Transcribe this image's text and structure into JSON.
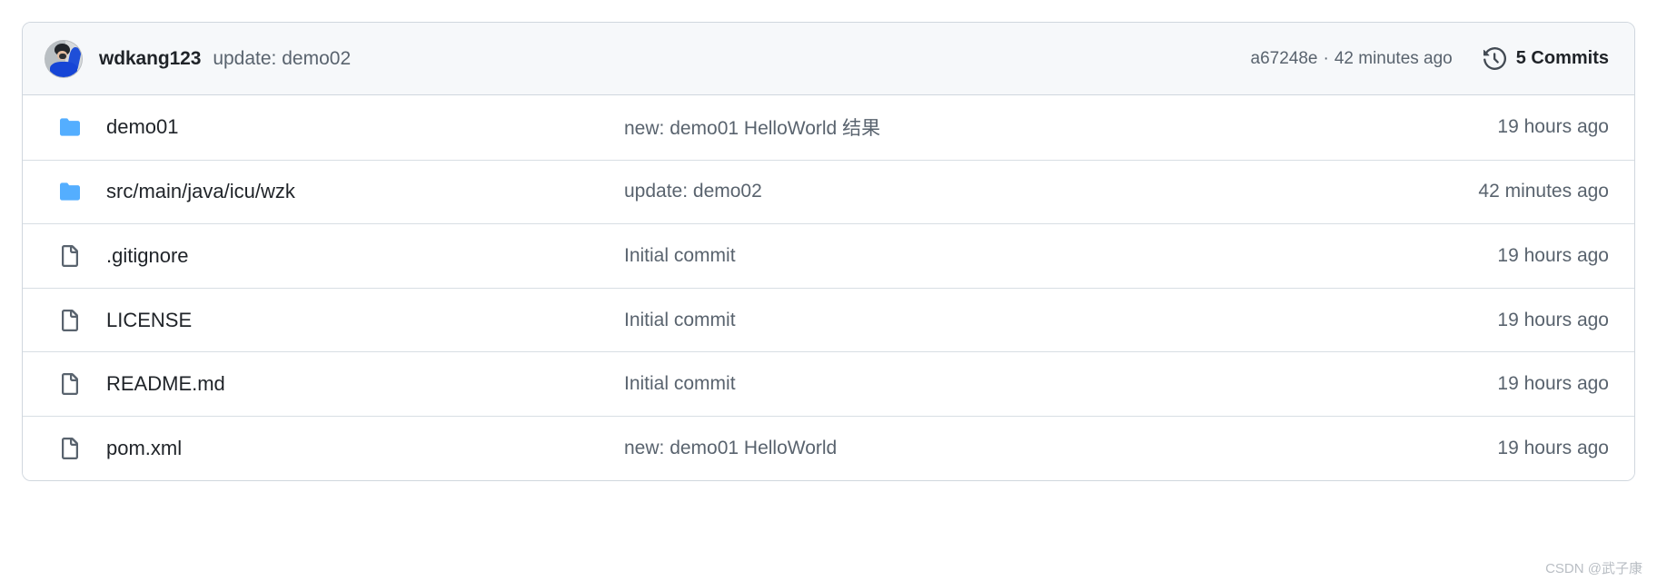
{
  "commit_header": {
    "avatar_name": "user-avatar",
    "author": "wdkang123",
    "message": "update: demo02",
    "commit_hash": "a67248e",
    "separator": "·",
    "relative_time": "42 minutes ago",
    "commits_label": "5 Commits",
    "history_icon": "history-icon"
  },
  "colors": {
    "folder_blue": "#54aeff",
    "file_gray": "#59636e",
    "header_bg": "#f6f8fa",
    "border": "#d0d7de",
    "text_primary": "#1f2328",
    "text_muted": "#59636e"
  },
  "rows": [
    {
      "icon": "folder-icon",
      "type": "directory",
      "name": "demo01",
      "message": "new: demo01 HelloWorld 结果",
      "time": "19 hours ago"
    },
    {
      "icon": "folder-icon",
      "type": "directory",
      "name": "src/main/java/icu/wzk",
      "message": "update: demo02",
      "time": "42 minutes ago"
    },
    {
      "icon": "file-icon",
      "type": "file",
      "name": ".gitignore",
      "message": "Initial commit",
      "time": "19 hours ago"
    },
    {
      "icon": "file-icon",
      "type": "file",
      "name": "LICENSE",
      "message": "Initial commit",
      "time": "19 hours ago"
    },
    {
      "icon": "file-icon",
      "type": "file",
      "name": "README.md",
      "message": "Initial commit",
      "time": "19 hours ago"
    },
    {
      "icon": "file-icon",
      "type": "file",
      "name": "pom.xml",
      "message": "new: demo01 HelloWorld",
      "time": "19 hours ago"
    }
  ],
  "watermark": "CSDN @武子康"
}
